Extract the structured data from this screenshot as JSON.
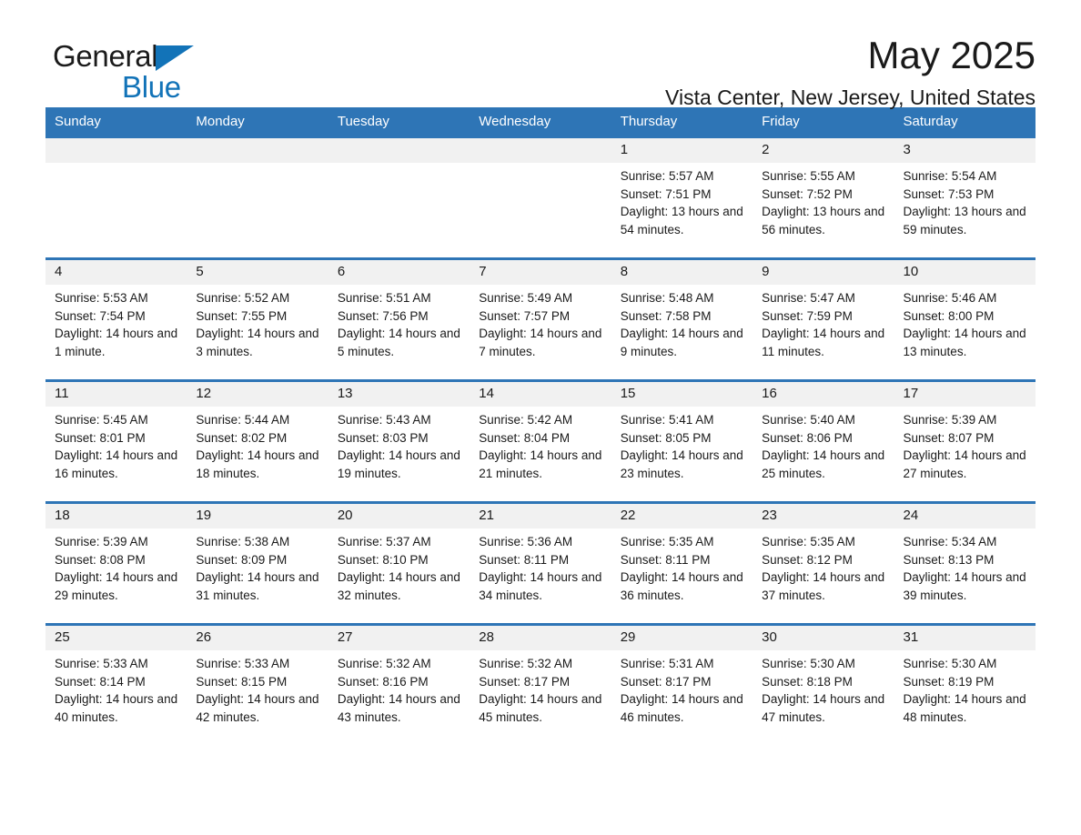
{
  "brand": {
    "word1": "General",
    "word2": "Blue",
    "triangle_color": "#1273B8"
  },
  "header": {
    "month_title": "May 2025",
    "location": "Vista Center, New Jersey, United States"
  },
  "colors": {
    "header_blue": "#2E75B6",
    "daynum_band": "#F1F1F1",
    "text": "#1a1a1a"
  },
  "weekday_headers": [
    "Sunday",
    "Monday",
    "Tuesday",
    "Wednesday",
    "Thursday",
    "Friday",
    "Saturday"
  ],
  "labels": {
    "sunrise": "Sunrise:",
    "sunset": "Sunset:",
    "daylight": "Daylight:"
  },
  "weeks": [
    [
      {
        "empty": true
      },
      {
        "empty": true
      },
      {
        "empty": true
      },
      {
        "empty": true
      },
      {
        "day": "1",
        "sunrise": "Sunrise: 5:57 AM",
        "sunset": "Sunset: 7:51 PM",
        "daylight": "Daylight: 13 hours and 54 minutes."
      },
      {
        "day": "2",
        "sunrise": "Sunrise: 5:55 AM",
        "sunset": "Sunset: 7:52 PM",
        "daylight": "Daylight: 13 hours and 56 minutes."
      },
      {
        "day": "3",
        "sunrise": "Sunrise: 5:54 AM",
        "sunset": "Sunset: 7:53 PM",
        "daylight": "Daylight: 13 hours and 59 minutes."
      }
    ],
    [
      {
        "day": "4",
        "sunrise": "Sunrise: 5:53 AM",
        "sunset": "Sunset: 7:54 PM",
        "daylight": "Daylight: 14 hours and 1 minute."
      },
      {
        "day": "5",
        "sunrise": "Sunrise: 5:52 AM",
        "sunset": "Sunset: 7:55 PM",
        "daylight": "Daylight: 14 hours and 3 minutes."
      },
      {
        "day": "6",
        "sunrise": "Sunrise: 5:51 AM",
        "sunset": "Sunset: 7:56 PM",
        "daylight": "Daylight: 14 hours and 5 minutes."
      },
      {
        "day": "7",
        "sunrise": "Sunrise: 5:49 AM",
        "sunset": "Sunset: 7:57 PM",
        "daylight": "Daylight: 14 hours and 7 minutes."
      },
      {
        "day": "8",
        "sunrise": "Sunrise: 5:48 AM",
        "sunset": "Sunset: 7:58 PM",
        "daylight": "Daylight: 14 hours and 9 minutes."
      },
      {
        "day": "9",
        "sunrise": "Sunrise: 5:47 AM",
        "sunset": "Sunset: 7:59 PM",
        "daylight": "Daylight: 14 hours and 11 minutes."
      },
      {
        "day": "10",
        "sunrise": "Sunrise: 5:46 AM",
        "sunset": "Sunset: 8:00 PM",
        "daylight": "Daylight: 14 hours and 13 minutes."
      }
    ],
    [
      {
        "day": "11",
        "sunrise": "Sunrise: 5:45 AM",
        "sunset": "Sunset: 8:01 PM",
        "daylight": "Daylight: 14 hours and 16 minutes."
      },
      {
        "day": "12",
        "sunrise": "Sunrise: 5:44 AM",
        "sunset": "Sunset: 8:02 PM",
        "daylight": "Daylight: 14 hours and 18 minutes."
      },
      {
        "day": "13",
        "sunrise": "Sunrise: 5:43 AM",
        "sunset": "Sunset: 8:03 PM",
        "daylight": "Daylight: 14 hours and 19 minutes."
      },
      {
        "day": "14",
        "sunrise": "Sunrise: 5:42 AM",
        "sunset": "Sunset: 8:04 PM",
        "daylight": "Daylight: 14 hours and 21 minutes."
      },
      {
        "day": "15",
        "sunrise": "Sunrise: 5:41 AM",
        "sunset": "Sunset: 8:05 PM",
        "daylight": "Daylight: 14 hours and 23 minutes."
      },
      {
        "day": "16",
        "sunrise": "Sunrise: 5:40 AM",
        "sunset": "Sunset: 8:06 PM",
        "daylight": "Daylight: 14 hours and 25 minutes."
      },
      {
        "day": "17",
        "sunrise": "Sunrise: 5:39 AM",
        "sunset": "Sunset: 8:07 PM",
        "daylight": "Daylight: 14 hours and 27 minutes."
      }
    ],
    [
      {
        "day": "18",
        "sunrise": "Sunrise: 5:39 AM",
        "sunset": "Sunset: 8:08 PM",
        "daylight": "Daylight: 14 hours and 29 minutes."
      },
      {
        "day": "19",
        "sunrise": "Sunrise: 5:38 AM",
        "sunset": "Sunset: 8:09 PM",
        "daylight": "Daylight: 14 hours and 31 minutes."
      },
      {
        "day": "20",
        "sunrise": "Sunrise: 5:37 AM",
        "sunset": "Sunset: 8:10 PM",
        "daylight": "Daylight: 14 hours and 32 minutes."
      },
      {
        "day": "21",
        "sunrise": "Sunrise: 5:36 AM",
        "sunset": "Sunset: 8:11 PM",
        "daylight": "Daylight: 14 hours and 34 minutes."
      },
      {
        "day": "22",
        "sunrise": "Sunrise: 5:35 AM",
        "sunset": "Sunset: 8:11 PM",
        "daylight": "Daylight: 14 hours and 36 minutes."
      },
      {
        "day": "23",
        "sunrise": "Sunrise: 5:35 AM",
        "sunset": "Sunset: 8:12 PM",
        "daylight": "Daylight: 14 hours and 37 minutes."
      },
      {
        "day": "24",
        "sunrise": "Sunrise: 5:34 AM",
        "sunset": "Sunset: 8:13 PM",
        "daylight": "Daylight: 14 hours and 39 minutes."
      }
    ],
    [
      {
        "day": "25",
        "sunrise": "Sunrise: 5:33 AM",
        "sunset": "Sunset: 8:14 PM",
        "daylight": "Daylight: 14 hours and 40 minutes."
      },
      {
        "day": "26",
        "sunrise": "Sunrise: 5:33 AM",
        "sunset": "Sunset: 8:15 PM",
        "daylight": "Daylight: 14 hours and 42 minutes."
      },
      {
        "day": "27",
        "sunrise": "Sunrise: 5:32 AM",
        "sunset": "Sunset: 8:16 PM",
        "daylight": "Daylight: 14 hours and 43 minutes."
      },
      {
        "day": "28",
        "sunrise": "Sunrise: 5:32 AM",
        "sunset": "Sunset: 8:17 PM",
        "daylight": "Daylight: 14 hours and 45 minutes."
      },
      {
        "day": "29",
        "sunrise": "Sunrise: 5:31 AM",
        "sunset": "Sunset: 8:17 PM",
        "daylight": "Daylight: 14 hours and 46 minutes."
      },
      {
        "day": "30",
        "sunrise": "Sunrise: 5:30 AM",
        "sunset": "Sunset: 8:18 PM",
        "daylight": "Daylight: 14 hours and 47 minutes."
      },
      {
        "day": "31",
        "sunrise": "Sunrise: 5:30 AM",
        "sunset": "Sunset: 8:19 PM",
        "daylight": "Daylight: 14 hours and 48 minutes."
      }
    ]
  ]
}
